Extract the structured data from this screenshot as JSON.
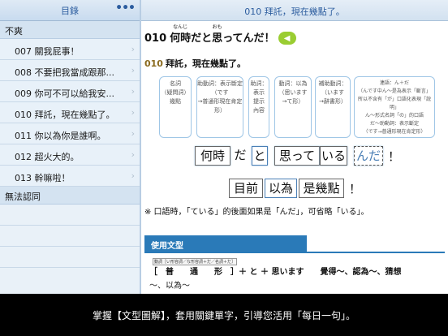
{
  "sidebar": {
    "title": "目錄",
    "more": "•••",
    "section1": "不爽",
    "items": [
      {
        "label": "007 關我屁事！"
      },
      {
        "label": "008 不要把我當成跟那..."
      },
      {
        "label": "009 你可不可以給我安..."
      },
      {
        "label": "010 拜託，現在幾點了。"
      },
      {
        "label": "011 你以為你是誰啊。"
      },
      {
        "label": "012 超火大的。"
      },
      {
        "label": "013 幹嘛啦！"
      }
    ],
    "section2": "無法認同",
    "chevron": "›"
  },
  "main": {
    "header": "010 拜託，現在幾點了。",
    "sentence": {
      "num": "010",
      "seg1": "何時",
      "seg1_ruby": "なんじ",
      "seg2": "だと",
      "seg3": "思",
      "seg3_ruby": "おも",
      "seg4": "ってんだ！",
      "speaker": "◀"
    },
    "translation": {
      "code": "010",
      "text": "拜託，現在幾點了。"
    },
    "bubbles": [
      {
        "l1": "名詞",
        "l2": "（疑問詞）",
        "l3": "幾點"
      },
      {
        "l1": "助動詞：表示斷定",
        "l2": "（です",
        "l3": "→普通形現在肯定形）"
      },
      {
        "l1": "助詞：",
        "l2": "表示",
        "l3": "提示",
        "l4": "內容"
      },
      {
        "l1": "動詞：以為",
        "l2": "（思います",
        "l3": "→て形）"
      },
      {
        "l1": "補助動詞：",
        "l2": "（います",
        "l3": "→辭書形）"
      },
      {
        "l1": "連語：ん＋だ",
        "l2": "（んです中ん～是為表示「斷言」",
        "l3": "所以不含有「が」口語化表現「說明」",
        "l4": "ん～形式名詞「の」的口語",
        "l5": "だ～助動詞：表示斷定",
        "l6": "（です→普通形現在肯定形）"
      }
    ],
    "words": [
      "何時",
      "だ",
      "と",
      "思って",
      "いる",
      "んだ"
    ],
    "exclaim": "！",
    "row2": [
      "目前",
      "以為",
      "是幾點"
    ],
    "note": "※ 口語時，「ている」的後面如果是「んだ」，可省略「いる」。",
    "usage": {
      "header": "使用文型",
      "label": "動詞［い形容詞／な形容詞＋だ／名詞＋だ］",
      "formula": "［　普　　通　　形　］＋ と ＋ 思います　　覺得～、認為～、猜想",
      "meaning": "～、以為～"
    }
  },
  "caption": "掌握【文型圖解】，套用關鍵單字，引導您活用「每日一句」。",
  "colors": {
    "accent": "#2b5c9e",
    "usage_blue": "#2a7ab8",
    "speaker_green": "#9acd32"
  }
}
